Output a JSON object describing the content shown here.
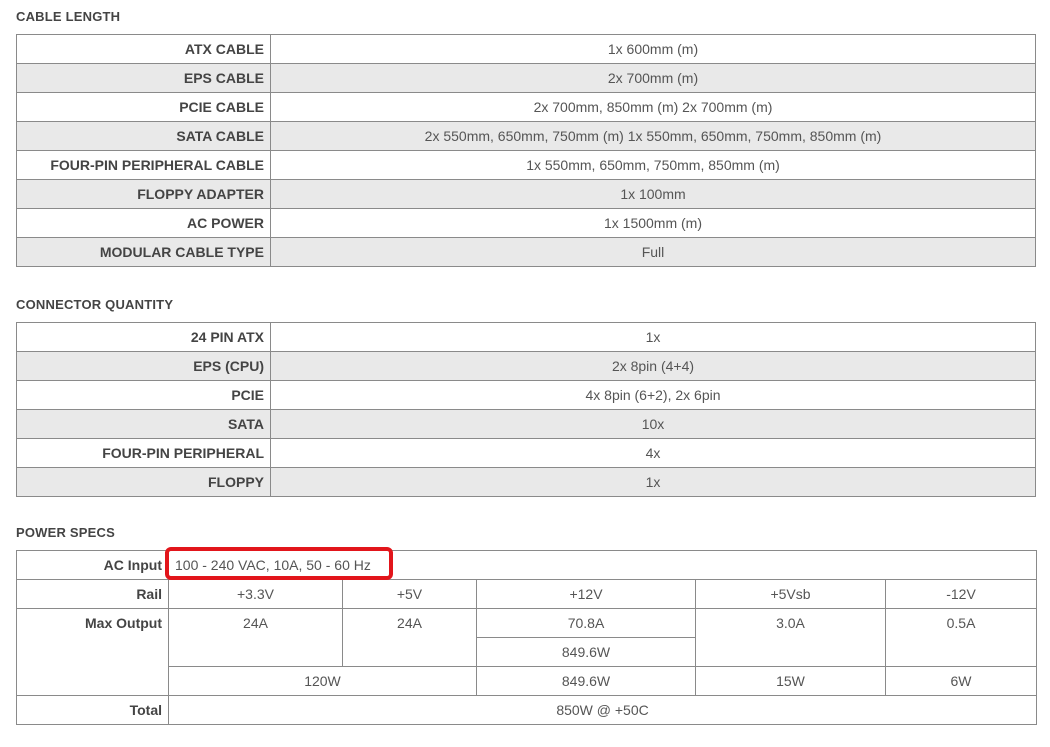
{
  "cable_length": {
    "title": "CABLE LENGTH",
    "rows": [
      {
        "label": "ATX CABLE",
        "value": "1x 600mm (m)"
      },
      {
        "label": "EPS CABLE",
        "value": "2x 700mm (m)"
      },
      {
        "label": "PCIE CABLE",
        "value": "2x 700mm, 850mm (m) 2x 700mm (m)"
      },
      {
        "label": "SATA CABLE",
        "value": "2x 550mm, 650mm, 750mm (m) 1x 550mm, 650mm, 750mm, 850mm (m)"
      },
      {
        "label": "FOUR-PIN PERIPHERAL CABLE",
        "value": "1x 550mm, 650mm, 750mm, 850mm (m)"
      },
      {
        "label": "FLOPPY ADAPTER",
        "value": "1x 100mm"
      },
      {
        "label": "AC POWER",
        "value": "1x 1500mm (m)"
      },
      {
        "label": "MODULAR CABLE TYPE",
        "value": "Full"
      }
    ]
  },
  "connector_quantity": {
    "title": "CONNECTOR QUANTITY",
    "rows": [
      {
        "label": "24 PIN ATX",
        "value": "1x"
      },
      {
        "label": "EPS (CPU)",
        "value": "2x 8pin (4+4)"
      },
      {
        "label": "PCIE",
        "value": "4x 8pin (6+2), 2x 6pin"
      },
      {
        "label": "SATA",
        "value": "10x"
      },
      {
        "label": "FOUR-PIN PERIPHERAL",
        "value": "4x"
      },
      {
        "label": "FLOPPY",
        "value": "1x"
      }
    ]
  },
  "power_specs": {
    "title": "POWER SPECS",
    "ac_input_label": "AC Input",
    "ac_input_value": "100 - 240 VAC, 10A, 50 - 60 Hz",
    "rail_label": "Rail",
    "rails": [
      "+3.3V",
      "+5V",
      "+12V",
      "+5Vsb",
      "-12V"
    ],
    "max_output_label": "Max Output",
    "max_output": [
      "24A",
      "24A",
      "70.8A",
      "3.0A",
      "0.5A"
    ],
    "twelve_v_watts": "849.6W",
    "combined": [
      "120W",
      "849.6W",
      "15W",
      "6W"
    ],
    "total_label": "Total",
    "total_value": "850W @ +50C"
  },
  "highlight_color": "#e2151b"
}
